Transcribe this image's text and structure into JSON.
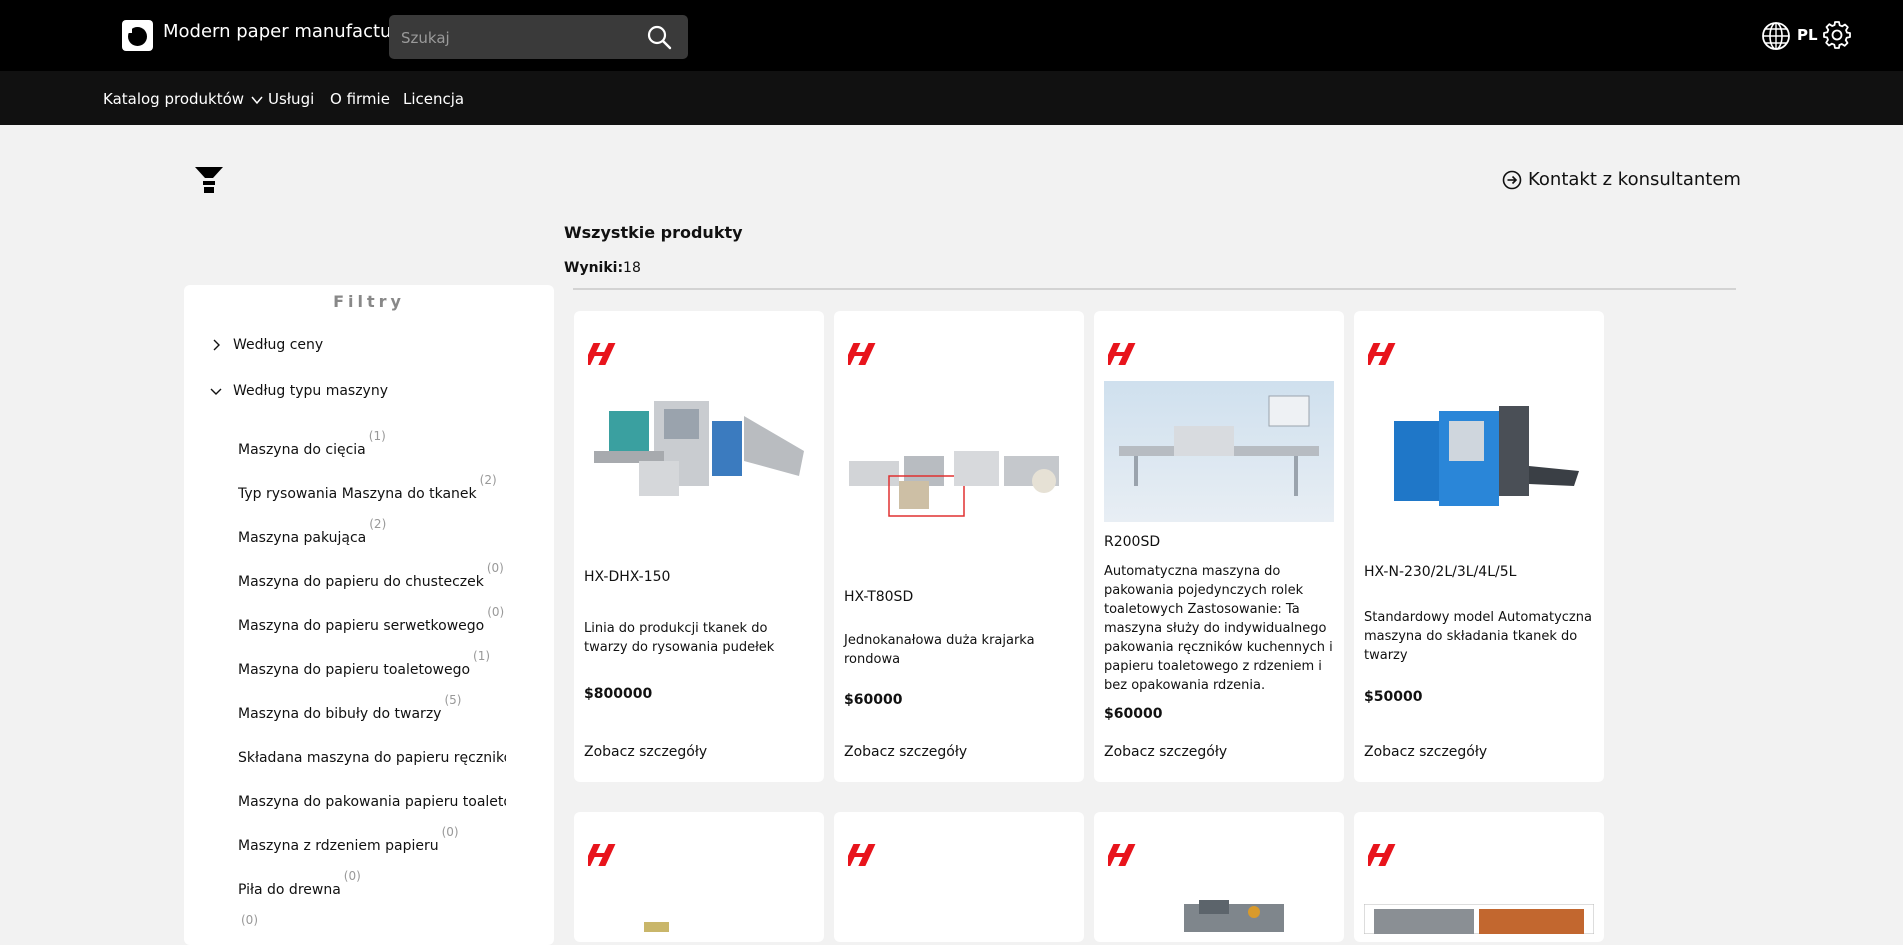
{
  "header": {
    "brand": "Modern paper manufacture",
    "search_placeholder": "Szukaj",
    "lang": "PL"
  },
  "nav": {
    "items": [
      "Katalog produktów",
      "Usługi",
      "O firmie",
      "Licencja"
    ]
  },
  "contact_label": "Kontakt z konsultantem",
  "section_title": "Wszystkie produkty",
  "results": {
    "label": "Wyniki:",
    "count": "18"
  },
  "filters": {
    "title": "Filtry",
    "groups": [
      "Według ceny",
      "Według typu maszyny"
    ],
    "options": [
      {
        "label": "Maszyna do cięcia",
        "count": "(1)"
      },
      {
        "label": "Typ rysowania Maszyna do tkanek",
        "count": "(2)"
      },
      {
        "label": "Maszyna pakująca",
        "count": "(2)"
      },
      {
        "label": "Maszyna do papieru do chusteczek",
        "count": "(0)"
      },
      {
        "label": "Maszyna do papieru serwetkowego",
        "count": "(0)"
      },
      {
        "label": "Maszyna do papieru toaletowego",
        "count": "(1)"
      },
      {
        "label": "Maszyna do bibuły do twarzy",
        "count": "(5)"
      },
      {
        "label": "Składana maszyna do papieru ręcznikowego",
        "count": ""
      },
      {
        "label": "Maszyna do pakowania papieru toaletowego",
        "count": ""
      },
      {
        "label": "Maszyna z rdzeniem papieru",
        "count": "(0)"
      },
      {
        "label": "Piła do drewna",
        "count": "(0)"
      },
      {
        "label": "",
        "count": "(0)"
      }
    ]
  },
  "products": [
    {
      "name": "HX-DHX-150",
      "desc": "Linia do produkcji tkanek do twarzy do rysowania pudełek",
      "price": "$800000",
      "details": "Zobacz szczegóły"
    },
    {
      "name": "HX-T80SD",
      "desc": "Jednokanałowa duża krajarka rondowa",
      "price": "$60000",
      "details": "Zobacz szczegóły"
    },
    {
      "name": "R200SD",
      "desc": "Automatyczna maszyna do pakowania pojedynczych rolek toaletowych Zastosowanie: Ta maszyna służy do indywidualnego pakowania ręczników kuchennych i papieru toaletowego z rdzeniem i bez opakowania rdzenia.",
      "price": "$60000",
      "details": "Zobacz szczegóły"
    },
    {
      "name": "HX-N-230/2L/3L/4L/5L",
      "desc": "Standardowy model Automatyczna maszyna do składania tkanek do twarzy",
      "price": "$50000",
      "details": "Zobacz szczegóły"
    }
  ],
  "colors": {
    "topbar": "#000000",
    "navbar": "#111111",
    "brand_red": "#e8141c",
    "page_bg": "#f2f2f2"
  }
}
